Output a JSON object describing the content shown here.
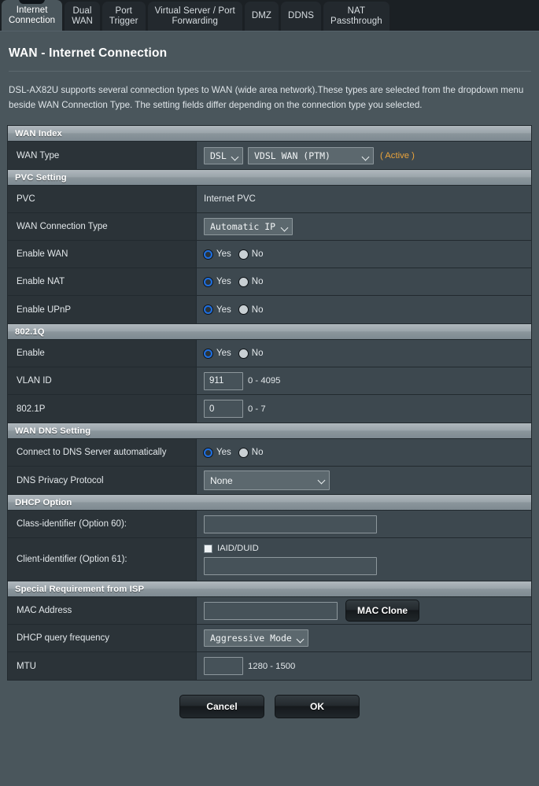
{
  "tabs": [
    {
      "label": "Internet\nConnection",
      "active": true
    },
    {
      "label": "Dual\nWAN",
      "active": false
    },
    {
      "label": "Port\nTrigger",
      "active": false
    },
    {
      "label": "Virtual Server / Port\nForwarding",
      "active": false
    },
    {
      "label": "DMZ",
      "active": false
    },
    {
      "label": "DDNS",
      "active": false
    },
    {
      "label": "NAT\nPassthrough",
      "active": false
    }
  ],
  "page": {
    "title": "WAN - Internet Connection",
    "description": "DSL-AX82U supports several connection types to WAN (wide area network).These types are selected from the dropdown menu beside WAN Connection Type. The setting fields differ depending on the connection type you selected."
  },
  "wan_index": {
    "section_title": "WAN Index",
    "wan_type_label": "WAN Type",
    "wan_type_value": "DSL",
    "wan_type_options": [
      "DSL"
    ],
    "wan_interface_value": "VDSL WAN (PTM)",
    "wan_interface_options": [
      "VDSL WAN (PTM)"
    ],
    "active_tag": "( Active )"
  },
  "pvc_setting": {
    "section_title": "PVC Setting",
    "pvc_label": "PVC",
    "pvc_value": "Internet PVC",
    "conn_type_label": "WAN Connection Type",
    "conn_type_value": "Automatic IP",
    "conn_type_options": [
      "Automatic IP"
    ],
    "enable_wan_label": "Enable WAN",
    "enable_wan_value": "Yes",
    "enable_nat_label": "Enable NAT",
    "enable_nat_value": "Yes",
    "enable_upnp_label": "Enable UPnP",
    "enable_upnp_value": "Yes"
  },
  "dot1q": {
    "section_title": "802.1Q",
    "enable_label": "Enable",
    "enable_value": "Yes",
    "vlan_id_label": "VLAN ID",
    "vlan_id_value": "911",
    "vlan_id_hint": "0 - 4095",
    "dot1p_label": "802.1P",
    "dot1p_value": "0",
    "dot1p_hint": "0 - 7"
  },
  "wan_dns": {
    "section_title": "WAN DNS Setting",
    "auto_dns_label": "Connect to DNS Server automatically",
    "auto_dns_value": "Yes",
    "privacy_label": "DNS Privacy Protocol",
    "privacy_value": "None",
    "privacy_options": [
      "None"
    ]
  },
  "dhcp_option": {
    "section_title": "DHCP Option",
    "class_id_label": "Class-identifier (Option 60):",
    "class_id_value": "",
    "client_id_label": "Client-identifier (Option 61):",
    "iaid_duid_label": "IAID/DUID",
    "iaid_duid_checked": false,
    "client_id_value": ""
  },
  "isp": {
    "section_title": "Special Requirement from ISP",
    "mac_label": "MAC Address",
    "mac_value": "",
    "mac_clone_label": "MAC Clone",
    "dhcp_freq_label": "DHCP query frequency",
    "dhcp_freq_value": "Aggressive Mode",
    "dhcp_freq_options": [
      "Aggressive Mode"
    ],
    "mtu_label": "MTU",
    "mtu_value": "",
    "mtu_hint": "1280 - 1500"
  },
  "footer": {
    "cancel_label": "Cancel",
    "ok_label": "OK"
  },
  "radio": {
    "yes": "Yes",
    "no": "No"
  }
}
